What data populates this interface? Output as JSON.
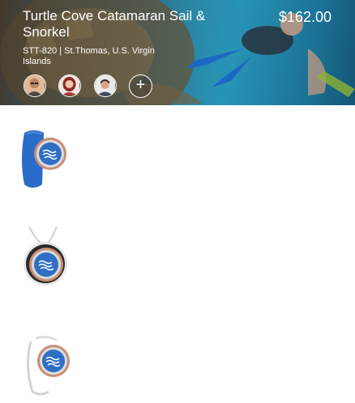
{
  "excursion": {
    "title": "Turtle Cove Catamaran Sail & Snorkel",
    "price": "$162.00",
    "code_location": "STT-820  |  St.Thomas, U.S. Virgin Islands",
    "add_guest_symbol": "+"
  },
  "guests": [
    {
      "icon": "guest-avatar-man-glasses"
    },
    {
      "icon": "guest-avatar-woman"
    },
    {
      "icon": "guest-avatar-man"
    }
  ],
  "wearables": [
    {
      "icon": "medallion-wristband-icon"
    },
    {
      "icon": "medallion-pendant-icon"
    },
    {
      "icon": "medallion-clip-icon"
    }
  ],
  "colors": {
    "medallion_blue": "#2f6fc4",
    "band_blue": "#2a6cc9"
  }
}
